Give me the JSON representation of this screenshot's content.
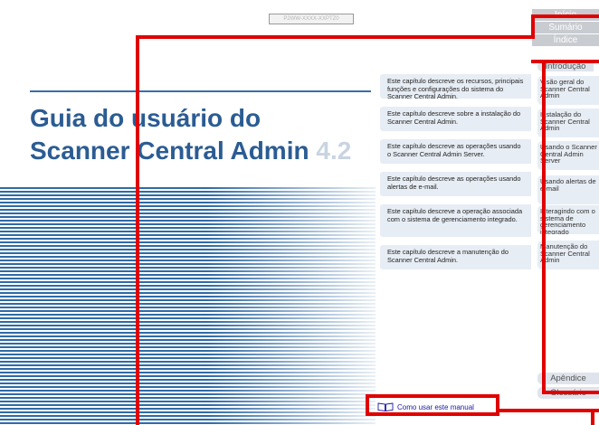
{
  "document": {
    "id_label": "P2WW-XXXX-XXPTZ0",
    "title_line1": "Guia do usuário do",
    "title_line2": "Scanner Central Admin",
    "title_version": "4.2"
  },
  "chapters": [
    {
      "desc": "Este capítulo descreve os recursos, principais funções e configurações do sistema do Scanner Central Admin.",
      "nav": "Visão geral do Scanner Central Admin"
    },
    {
      "desc": "Este capítulo descreve sobre a instalação do Scanner Central Admin.",
      "nav": "Instalação do Scanner Central Admin"
    },
    {
      "desc": "Este capítulo descreve as operações usando o Scanner Central Admin Server.",
      "nav": "Usando o Scanner Central Admin Server"
    },
    {
      "desc": "Este capítulo descreve as operações usando alertas de e-mail.",
      "nav": "Usando alertas de e-mail"
    },
    {
      "desc": "Este capítulo descreve a operação associada com o sistema de gerenciamento integrado.",
      "nav": "Interagindo com o sistema de gerenciamento integrado"
    },
    {
      "desc": "Este capítulo descreve a manutenção do Scanner Central Admin.",
      "nav": "Manutenção do Scanner Central Admin"
    }
  ],
  "sidebar": {
    "inicio": "Início",
    "sumario": "Sumário",
    "indice": "Índice",
    "introducao": "Introdução",
    "apendice": "Apêndice",
    "glossario": "Glossário"
  },
  "footer": {
    "how_to_use": "Como usar este manual",
    "icon": "book-icon"
  },
  "colors": {
    "title_blue": "#2b5c93",
    "stripe_blue": "#2f6aa6",
    "highlight_red": "#e00000",
    "sidebar_gray": "#c8cbd0",
    "panel_light": "#e7edf4"
  }
}
